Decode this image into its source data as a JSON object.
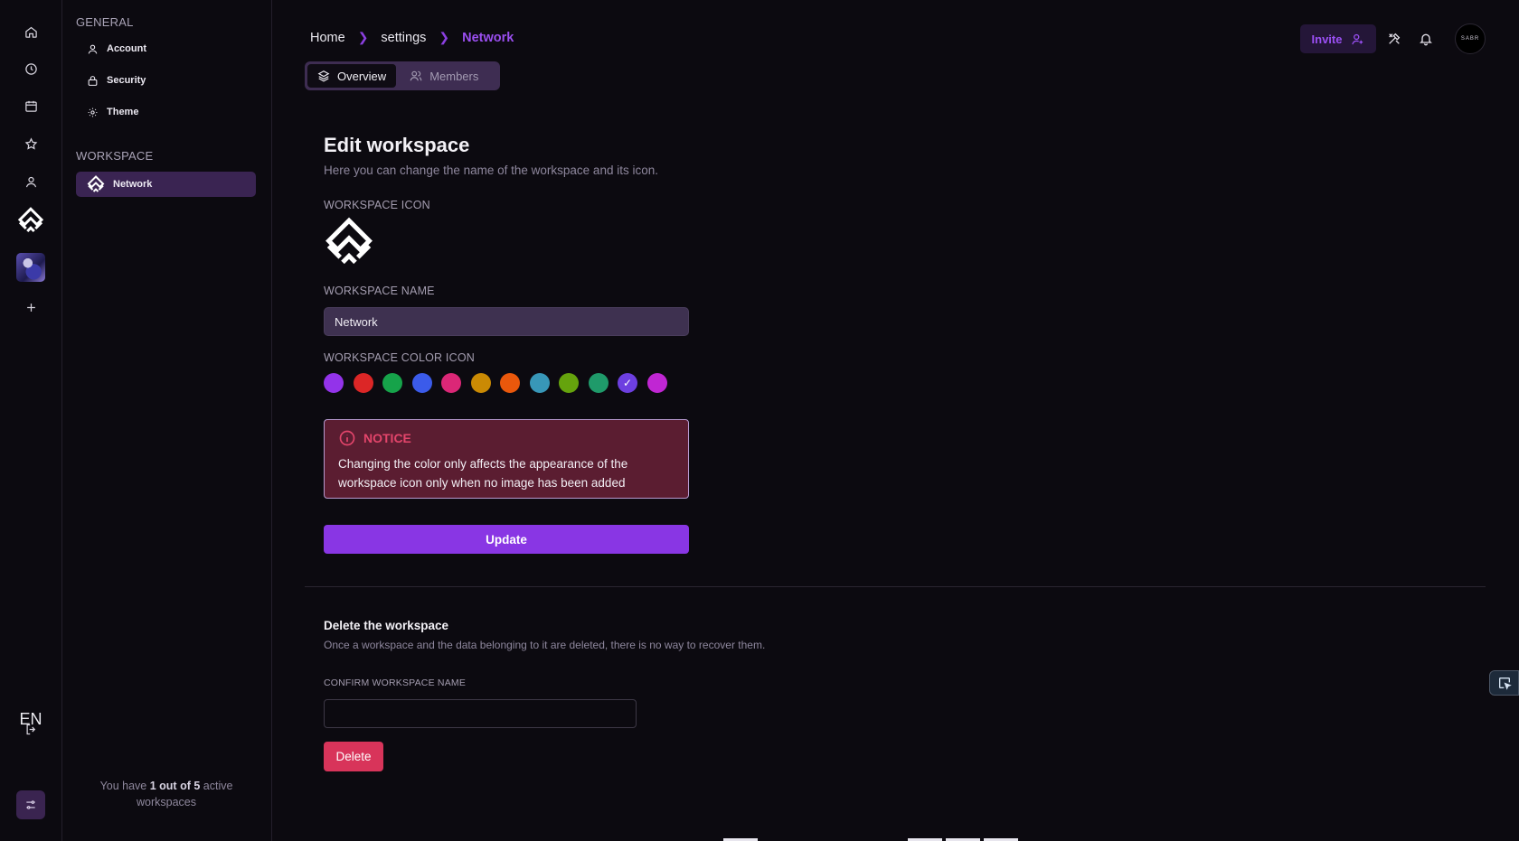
{
  "rail": {
    "language": "EN"
  },
  "sidebar": {
    "general_heading": "GENERAL",
    "general_items": [
      {
        "label": "Account"
      },
      {
        "label": "Security"
      },
      {
        "label": "Theme"
      }
    ],
    "workspace_heading": "WORKSPACE",
    "workspace_items": [
      {
        "label": "Network"
      }
    ],
    "footer": {
      "prefix": "You have",
      "count": "1 out of 5",
      "suffix": "active workspaces"
    }
  },
  "breadcrumb": [
    "Home",
    "settings",
    "Network"
  ],
  "header": {
    "invite_label": "Invite",
    "profile_text": "SABR"
  },
  "tabs": [
    {
      "label": "Overview",
      "active": true
    },
    {
      "label": "Members",
      "active": false
    }
  ],
  "edit": {
    "title": "Edit workspace",
    "subtitle": "Here you can change the name of the workspace and its icon.",
    "icon_label": "WORKSPACE ICON",
    "name_label": "WORKSPACE NAME",
    "name_value": "Network",
    "color_label": "WORKSPACE COLOR ICON",
    "colors": [
      "#9333ea",
      "#dc2626",
      "#16a34a",
      "#3b5bea",
      "#db2777",
      "#ca8a04",
      "#ea580c",
      "#3897b8",
      "#65a30d",
      "#1f9a6a",
      "#6d3fe0",
      "#c026d3"
    ],
    "selected_color_index": 10,
    "notice_title": "NOTICE",
    "notice_body": "Changing the color only affects the appearance of the workspace icon only when no image has been added",
    "update_label": "Update"
  },
  "delete": {
    "title": "Delete the workspace",
    "subtitle": "Once a workspace and the data belonging to it are deleted, there is no way to recover them.",
    "confirm_label": "CONFIRM WORKSPACE NAME",
    "confirm_value": "",
    "delete_label": "Delete"
  }
}
